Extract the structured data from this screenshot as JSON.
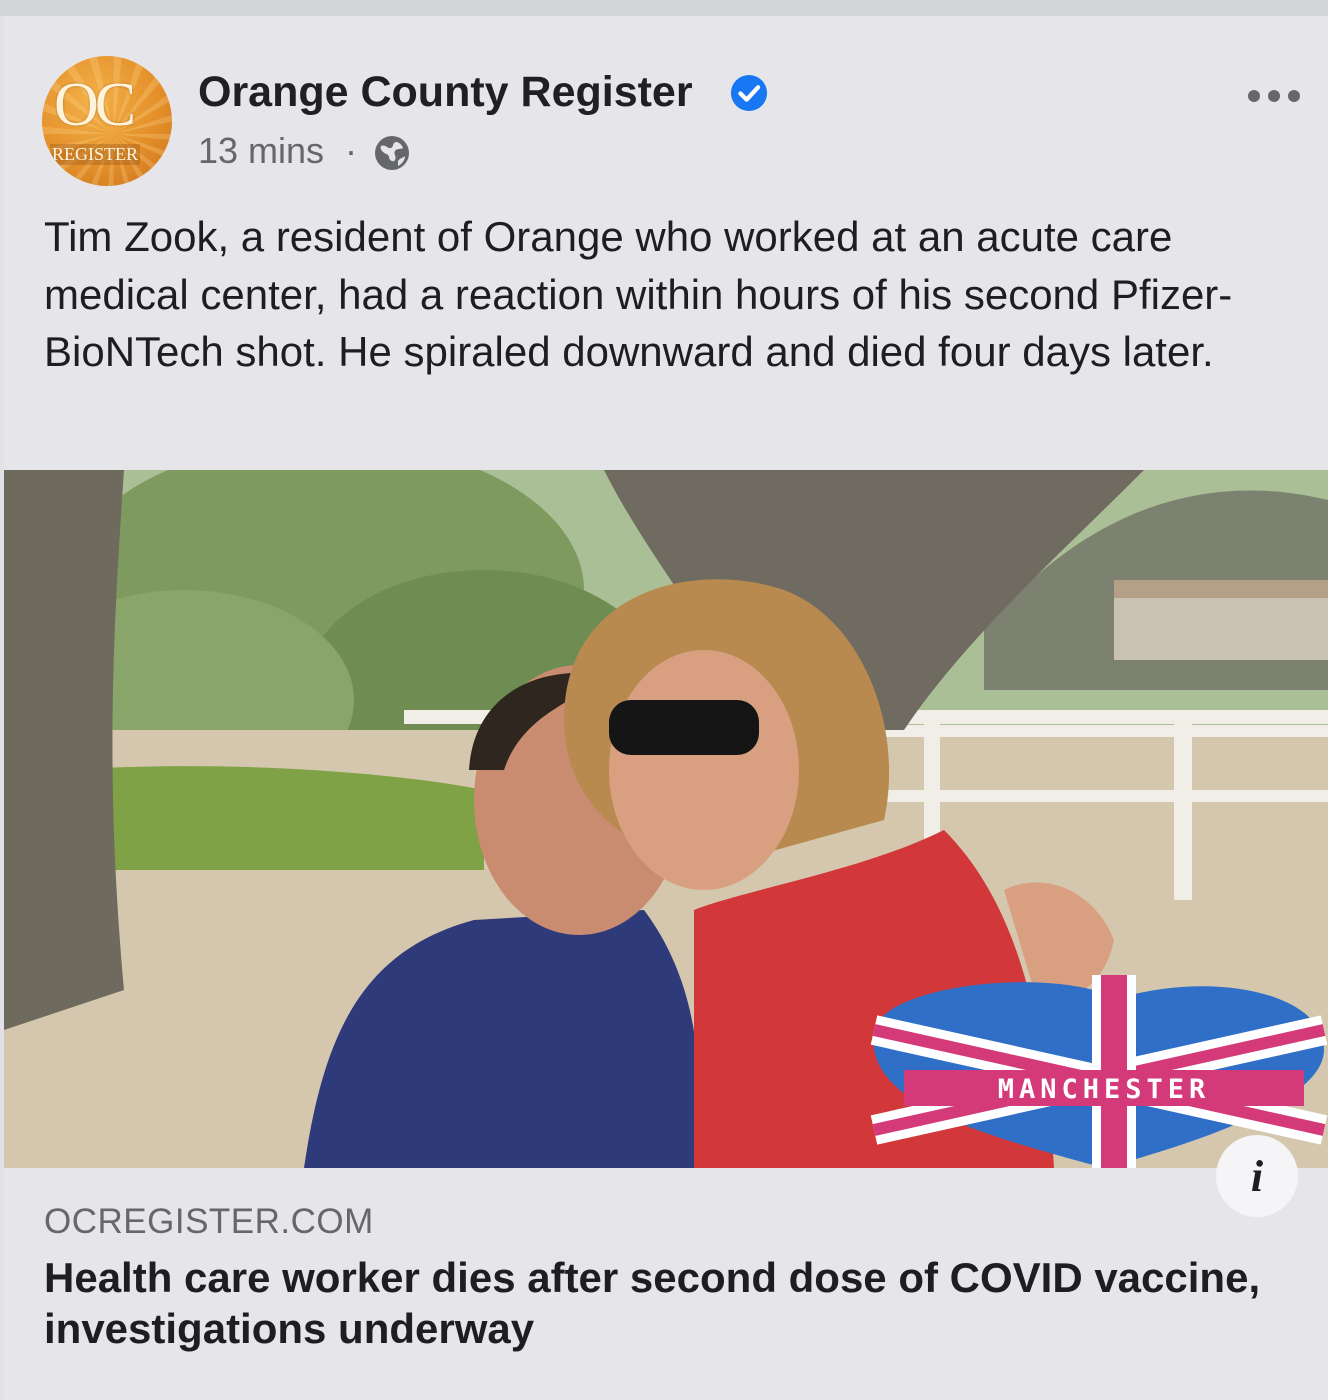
{
  "post": {
    "page_name": "Orange County Register",
    "avatar_text_top": "OC",
    "avatar_text_bottom": "REGISTER",
    "timestamp": "13 mins",
    "separator": "·",
    "verified_icon": "verified-badge-icon",
    "audience_icon": "globe-icon",
    "more_icon": "more-options-icon",
    "text": "Tim Zook, a resident of Orange who worked at an acute care medical center, had a reaction within hours of his second Pfizer-BioNTech shot. He spiraled downward and died four days later."
  },
  "link_preview": {
    "image_sticker_text": "MANCHESTER",
    "info_icon": "info-icon",
    "info_glyph": "i",
    "domain": "OCREGISTER.COM",
    "title": "Health care worker dies after second dose of COVID vaccine, investigations underway"
  },
  "colors": {
    "background": "#e6e6ea",
    "verified_blue": "#1877f2",
    "secondary_text": "#65676b"
  }
}
